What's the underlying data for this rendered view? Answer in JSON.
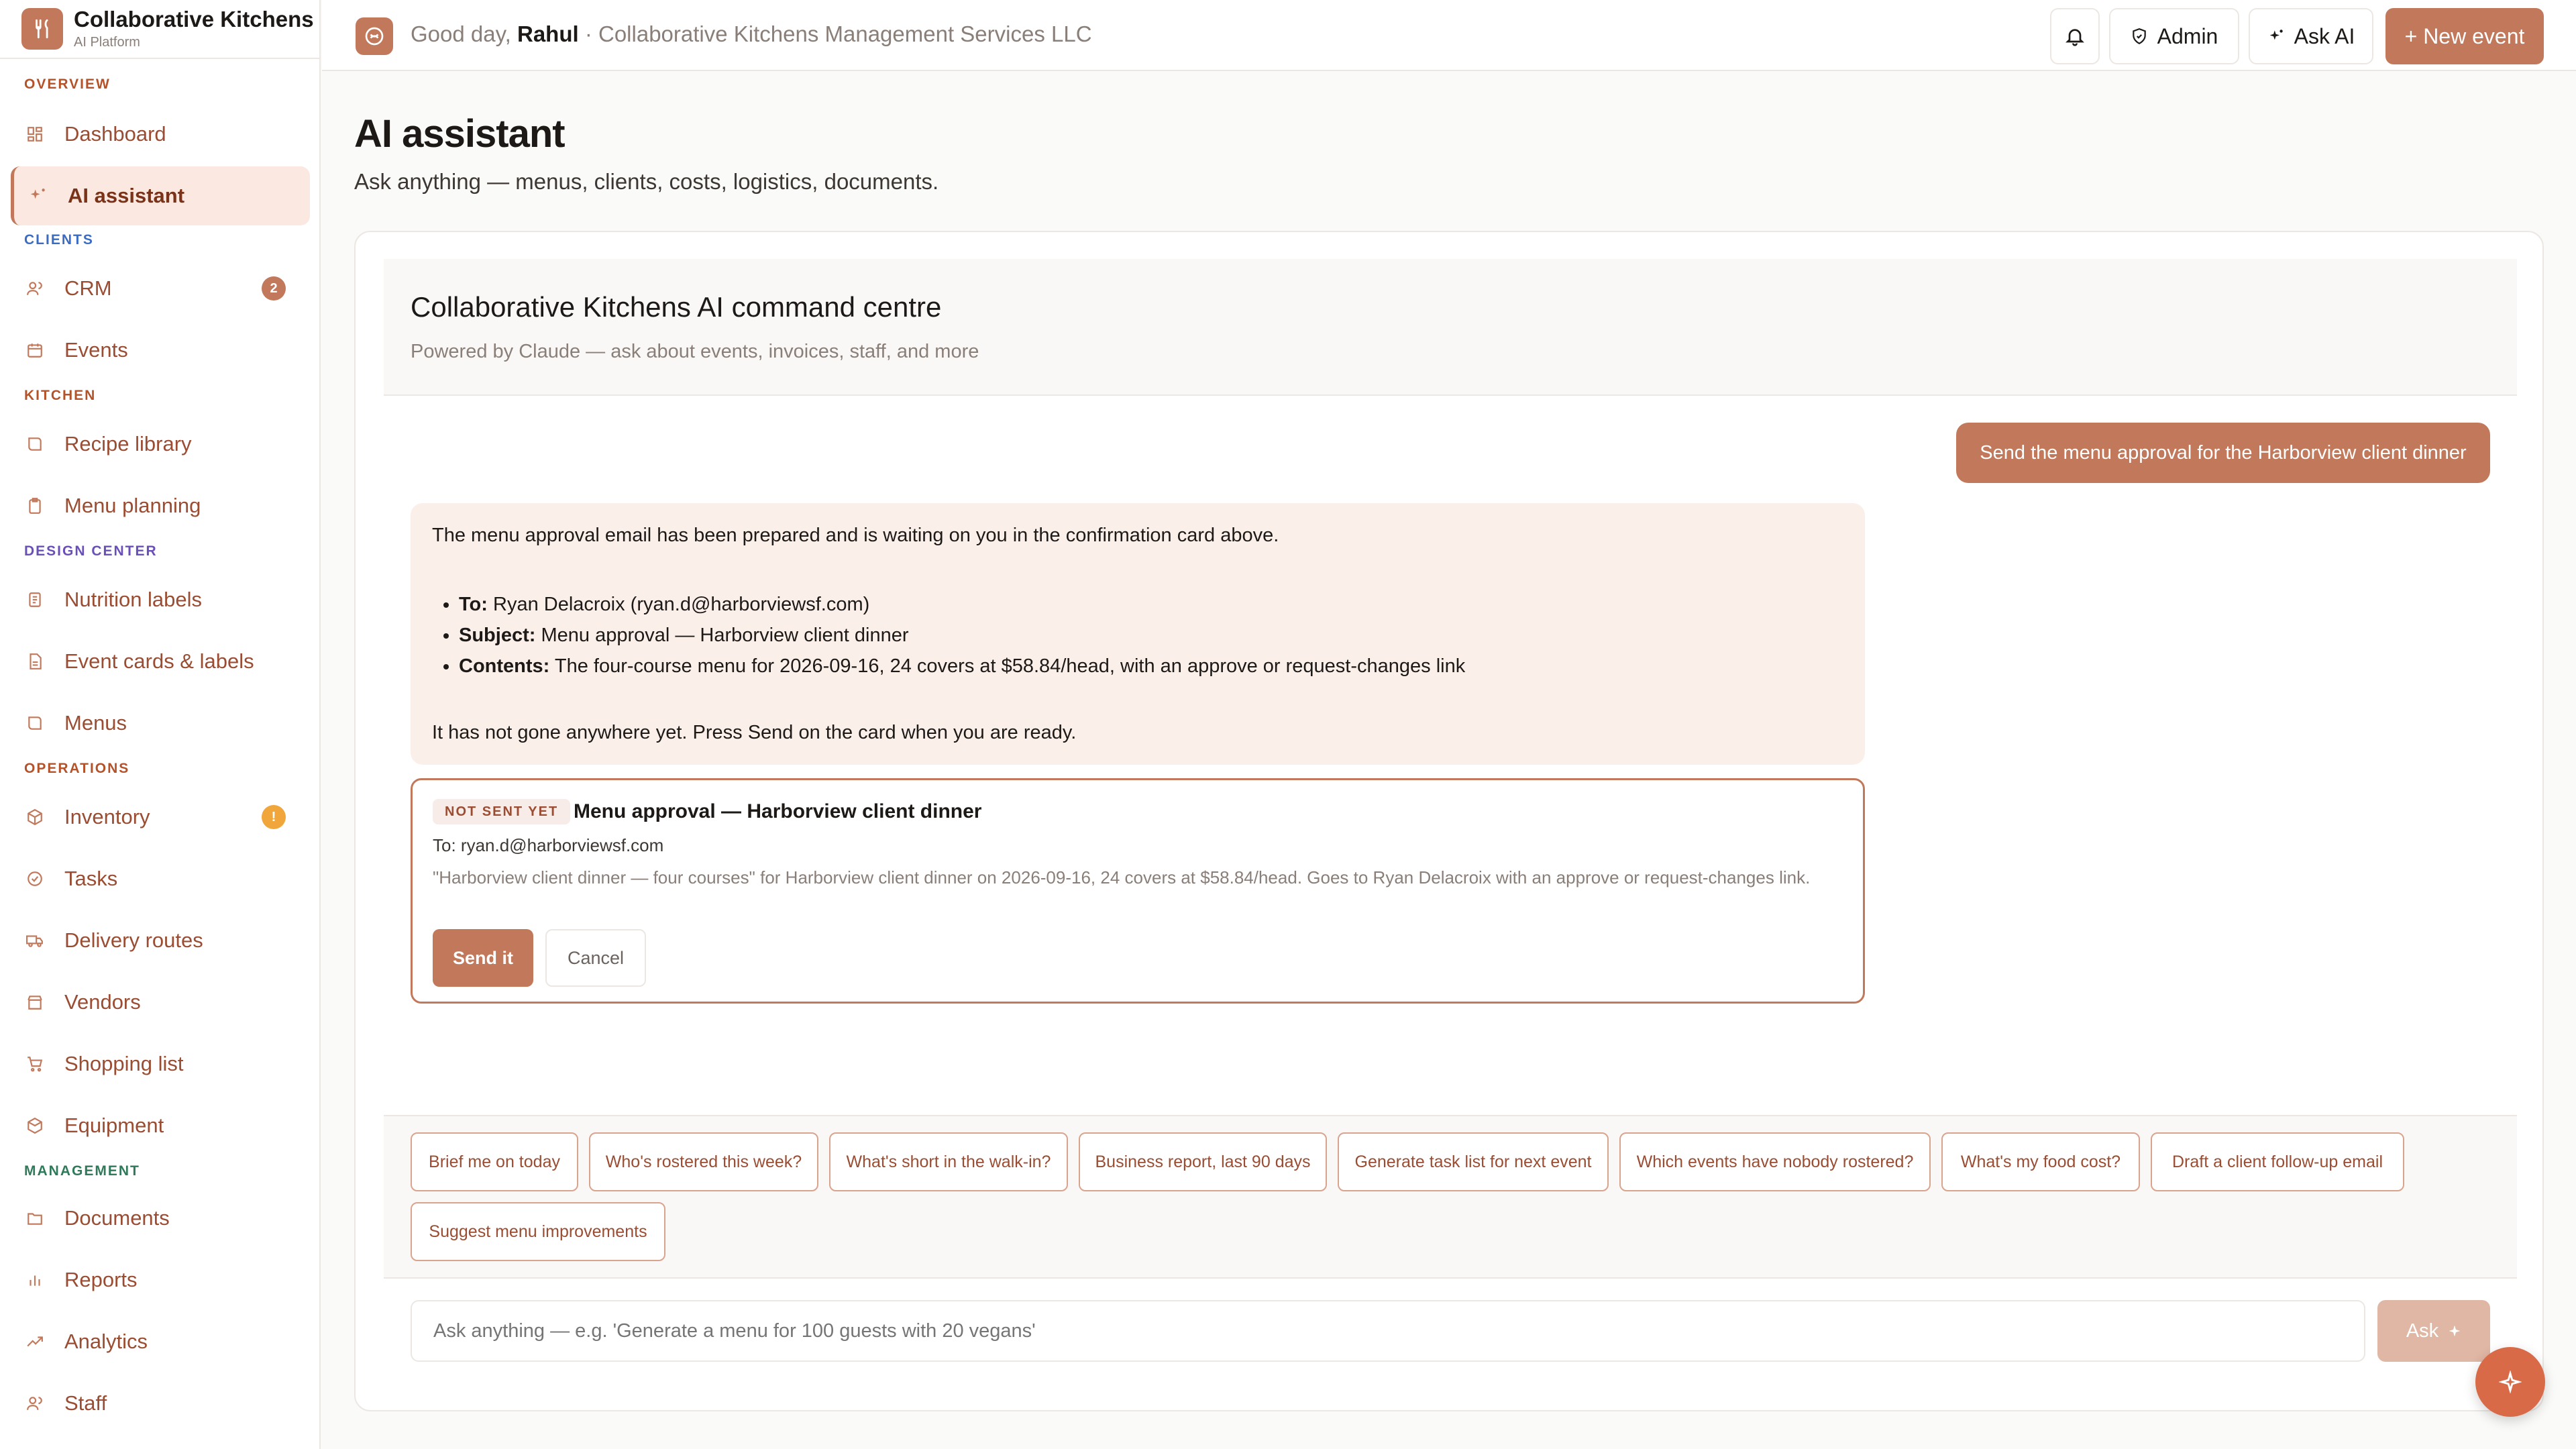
{
  "brand": {
    "name": "Collaborative Kitchens",
    "subtitle": "AI Platform"
  },
  "sidebar": {
    "sections": {
      "overview": "OVERVIEW",
      "clients": "CLIENTS",
      "kitchen": "KITCHEN",
      "design_center": "DESIGN CENTER",
      "operations": "OPERATIONS",
      "management": "MANAGEMENT"
    },
    "items": {
      "dashboard": "Dashboard",
      "ai_assistant": "AI assistant",
      "crm": "CRM",
      "crm_badge": "2",
      "events": "Events",
      "recipe_library": "Recipe library",
      "menu_planning": "Menu planning",
      "nutrition_labels": "Nutrition labels",
      "event_cards": "Event cards & labels",
      "menus": "Menus",
      "inventory": "Inventory",
      "inventory_badge": "!",
      "tasks": "Tasks",
      "delivery_routes": "Delivery routes",
      "vendors": "Vendors",
      "shopping_list": "Shopping list",
      "equipment": "Equipment",
      "documents": "Documents",
      "reports": "Reports",
      "analytics": "Analytics",
      "staff": "Staff"
    },
    "colors": {
      "overview": "#b4532a",
      "clients": "#3b6cc4",
      "kitchen": "#b4532a",
      "design_center": "#6b4fb8",
      "operations": "#b4532a",
      "management": "#2f7a5a"
    }
  },
  "header": {
    "greeting_prefix": "Good day,",
    "user_name": "Rahul",
    "company": "· Collaborative Kitchens Management Services LLC",
    "admin_label": "Admin",
    "ask_ai_label": "Ask AI",
    "new_event_label": "+ New event"
  },
  "page": {
    "title": "AI assistant",
    "subtitle": "Ask anything — menus, clients, costs, logistics, documents."
  },
  "assistant": {
    "title": "Collaborative Kitchens AI command centre",
    "subtitle": "Powered by Claude — ask about events, invoices, staff, and more",
    "user_message": "Send the menu approval for the Harborview client dinner",
    "ai_intro": "The menu approval email has been prepared and is waiting on you in the confirmation card above.",
    "to_label": "To:",
    "to_value": "Ryan Delacroix (ryan.d@harborviewsf.com)",
    "subject_label": "Subject:",
    "subject_value": "Menu approval — Harborview client dinner",
    "contents_label": "Contents:",
    "contents_value": "The four-course menu for 2026-09-16, 24 covers at $58.84/head, with an approve or request-changes link",
    "ai_outro": "It has not gone anywhere yet. Press Send on the card when you are ready."
  },
  "confirm_card": {
    "badge": "NOT SENT YET",
    "title": "Menu approval — Harborview client dinner",
    "to": "To: ryan.d@harborviewsf.com",
    "body": "\"Harborview client dinner — four courses\" for Harborview client dinner on 2026-09-16, 24 covers at $58.84/head. Goes to Ryan Delacroix with an approve or request-changes link.",
    "send_label": "Send it",
    "cancel_label": "Cancel"
  },
  "suggestions": [
    "Brief me on today",
    "Who's rostered this week?",
    "What's short in the walk-in?",
    "Business report, last 90 days",
    "Generate task list for next event",
    "Which events have nobody rostered?",
    "What's my food cost?",
    "Draft a client follow-up email",
    "Suggest menu improvements"
  ],
  "composer": {
    "placeholder": "Ask anything — e.g. 'Generate a menu for 100 guests with 20 vegans'",
    "ask_label": "Ask"
  },
  "colors": {
    "accent": "#c2785a",
    "accent_light": "#fbe9e1",
    "warning": "#f0a63a"
  }
}
